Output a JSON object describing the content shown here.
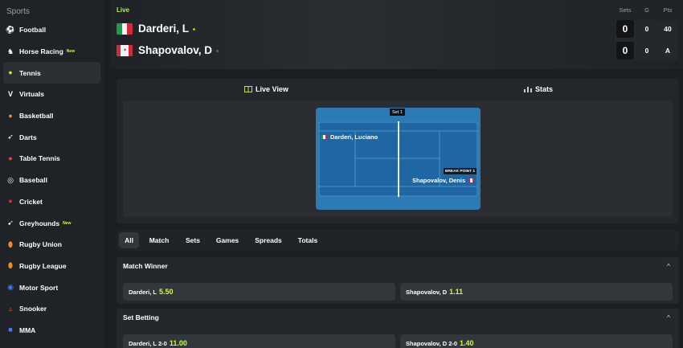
{
  "sidebar": {
    "title": "Sports",
    "items": [
      {
        "label": "Football",
        "icon": "football-icon",
        "glyph": "⚽",
        "color": "#ffffff"
      },
      {
        "label": "Horse Racing",
        "icon": "horse-icon",
        "glyph": "♞",
        "color": "#ffffff",
        "badge": "New"
      },
      {
        "label": "Tennis",
        "icon": "tennis-ball-icon",
        "glyph": "●",
        "color": "#b7e34b"
      },
      {
        "label": "Virtuals",
        "icon": "virtuals-icon",
        "glyph": "V",
        "color": "#ffffff"
      },
      {
        "label": "Basketball",
        "icon": "basketball-icon",
        "glyph": "●",
        "color": "#f08a24"
      },
      {
        "label": "Darts",
        "icon": "darts-icon",
        "glyph": "➶",
        "color": "#ffffff"
      },
      {
        "label": "Table Tennis",
        "icon": "table-tennis-icon",
        "glyph": "●",
        "color": "#e8453c"
      },
      {
        "label": "Baseball",
        "icon": "baseball-icon",
        "glyph": "◎",
        "color": "#ffffff"
      },
      {
        "label": "Cricket",
        "icon": "cricket-icon",
        "glyph": "●",
        "color": "#d9342b"
      },
      {
        "label": "Greyhounds",
        "icon": "greyhound-icon",
        "glyph": "➹",
        "color": "#ffffff",
        "badge": "New"
      },
      {
        "label": "Rugby Union",
        "icon": "rugby-ball-icon",
        "glyph": "⬮",
        "color": "#f08a24"
      },
      {
        "label": "Rugby League",
        "icon": "rugby-ball-icon",
        "glyph": "⬮",
        "color": "#f08a24"
      },
      {
        "label": "Motor Sport",
        "icon": "motor-sport-icon",
        "glyph": "◉",
        "color": "#4a7de6"
      },
      {
        "label": "Snooker",
        "icon": "snooker-icon",
        "glyph": "▵",
        "color": "#e8453c"
      },
      {
        "label": "MMA",
        "icon": "mma-glove-icon",
        "glyph": "■",
        "color": "#4a7de6"
      }
    ],
    "active_index": 2
  },
  "header": {
    "live": "Live",
    "score_headers": {
      "sets": "Sets",
      "games": "G",
      "points": "Pts"
    },
    "players": [
      {
        "name": "Darderi, L",
        "sets": "0",
        "games": "0",
        "points": "40",
        "serving": true
      },
      {
        "name": "Shapovalov, D",
        "sets": "0",
        "games": "0",
        "points": "A",
        "serving": false
      }
    ]
  },
  "view_tabs": {
    "live_view": "Live View",
    "stats": "Stats"
  },
  "court": {
    "set_label": "Set 1",
    "player1": "Darderi, Luciano",
    "player2": "Shapovalov, Denis",
    "event": "BREAK POINT 1"
  },
  "market_tabs": [
    "All",
    "Match",
    "Sets",
    "Games",
    "Spreads",
    "Totals"
  ],
  "markets": {
    "match_winner": {
      "title": "Match Winner",
      "selections": [
        {
          "label": "Darderi, L",
          "odds": "5.50"
        },
        {
          "label": "Shapovalov, D",
          "odds": "1.11"
        }
      ]
    },
    "set_betting": {
      "title": "Set Betting",
      "selections": [
        {
          "label": "Darderi, L 2-0",
          "odds": "11.00"
        },
        {
          "label": "Shapovalov, D 2-0",
          "odds": "1.40"
        }
      ]
    }
  },
  "colors": {
    "accent": "#c6ff3b",
    "court": "#2d7bb4",
    "background": "#1b1e22"
  }
}
